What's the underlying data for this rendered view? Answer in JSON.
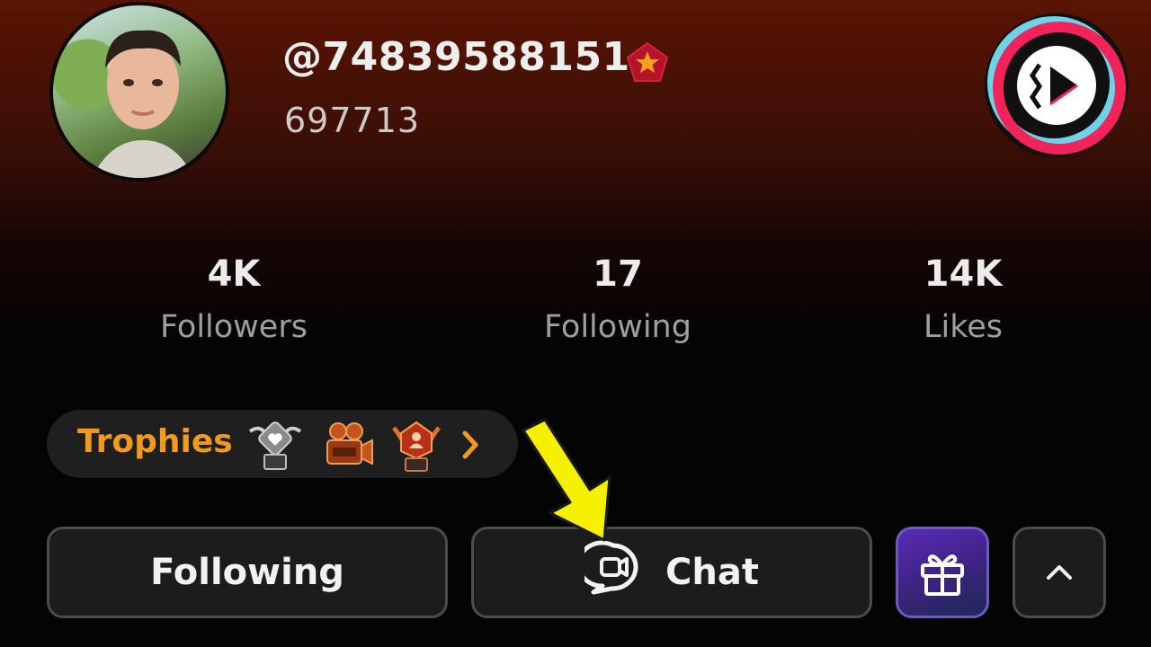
{
  "profile": {
    "username": "@74839588151",
    "user_id": "697713",
    "badge_icon": "star-pentagon-badge-icon",
    "logo_icon": "tiktok-lite-logo-icon"
  },
  "stats": [
    {
      "value": "4K",
      "label": "Followers"
    },
    {
      "value": "17",
      "label": "Following"
    },
    {
      "value": "14K",
      "label": "Likes"
    }
  ],
  "trophies": {
    "label": "Trophies",
    "icons": [
      "heart-trophy-icon",
      "video-camera-trophy-icon",
      "profile-trophy-icon"
    ],
    "chevron": "chevron-right-icon"
  },
  "actions": {
    "following_label": "Following",
    "chat_label": "Chat",
    "chat_icon": "chat-video-icon",
    "gift_icon": "gift-icon",
    "expand_icon": "chevron-up-icon"
  },
  "colors": {
    "trophies_text": "#f29b1b",
    "gift_button": "#4a2aa0",
    "annotation_arrow": "#f5f000"
  }
}
